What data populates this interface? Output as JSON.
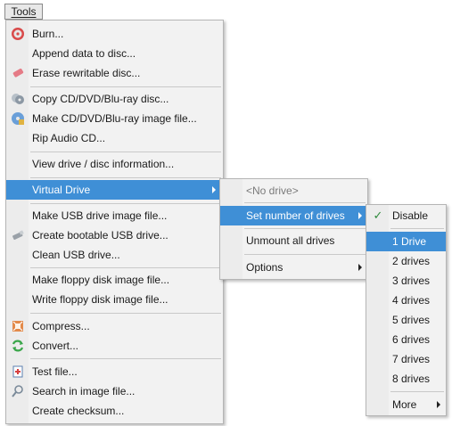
{
  "menubar": {
    "tools_label": "Tools"
  },
  "tools_menu": {
    "burn": "Burn...",
    "append": "Append data to disc...",
    "erase": "Erase rewritable disc...",
    "copy": "Copy CD/DVD/Blu-ray disc...",
    "make_image": "Make CD/DVD/Blu-ray image file...",
    "rip": "Rip Audio CD...",
    "view_info": "View drive / disc information...",
    "virtual_drive": "Virtual Drive",
    "make_usb_image": "Make USB drive image file...",
    "bootable_usb": "Create bootable USB drive...",
    "clean_usb": "Clean USB drive...",
    "make_floppy": "Make floppy disk image file...",
    "write_floppy": "Write floppy disk image file...",
    "compress": "Compress...",
    "convert": "Convert...",
    "test": "Test file...",
    "search": "Search in image file...",
    "checksum": "Create checksum..."
  },
  "virtual_drive_menu": {
    "no_drive": "<No drive>",
    "set_number": "Set number of drives",
    "unmount_all": "Unmount all drives",
    "options": "Options"
  },
  "drives_menu": {
    "disable": "Disable",
    "d1": "1 Drive",
    "d2": "2 drives",
    "d3": "3 drives",
    "d4": "4 drives",
    "d5": "5 drives",
    "d6": "6 drives",
    "d7": "7 drives",
    "d8": "8 drives",
    "more": "More"
  },
  "colors": {
    "highlight": "#3f8fd6",
    "menu_bg": "#f2f2f2"
  }
}
